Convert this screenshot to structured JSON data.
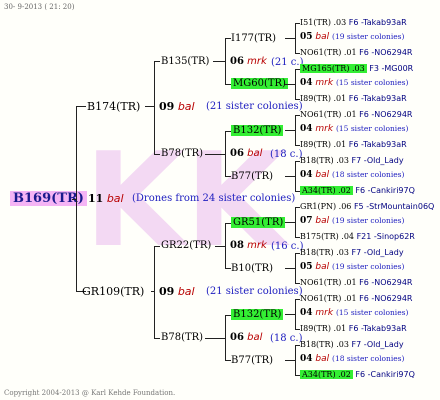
{
  "header_date": "30- 9-2013 ( 21: 20)",
  "copyright": "Copyright 2004-2013 @ Karl Kehde Foundation.",
  "watermark": "KK",
  "root": {
    "id": "B169(TR)",
    "num": "11",
    "mark": "bal",
    "note": "(Drones from 24 sister colonies)"
  },
  "upper": {
    "id": "B174(TR)",
    "num": "09",
    "mark": "bal",
    "note": "(21 sister colonies)",
    "a": {
      "id": "B135(TR)",
      "num": "06",
      "mark": "mrk",
      "note": "(21 c.)",
      "q1": "I177(TR)",
      "q2": "MG60(TR)"
    },
    "b": {
      "id": "B78(TR)",
      "num": "06",
      "mark": "bal",
      "note": "(18 c.)",
      "q1": "B132(TR)",
      "q2": "B77(TR)"
    }
  },
  "lower": {
    "id": "GR109(TR)",
    "num": "09",
    "mark": "bal",
    "note": "(21 sister colonies)",
    "a": {
      "id": "GR22(TR)",
      "num": "08",
      "mark": "mrk",
      "note": "(16 c.)",
      "q1": "GR51(TR)",
      "q2": "B10(TR)"
    },
    "b": {
      "id": "B78(TR)",
      "num": "06",
      "mark": "bal",
      "note": "(18 c.)",
      "q1": "B132(TR)",
      "q2": "B77(TR)"
    }
  },
  "gen4": [
    {
      "a": "I51(TR) .03",
      "b": "F6 -Takab93aR",
      "num": "05",
      "mark": "bal",
      "note": "(19 sister colonies)",
      "c": "NO61(TR) .01",
      "d": "F6 -NO6294R"
    },
    {
      "a": "MG165(TR) .03",
      "b": "F3 -MG00R",
      "num": "04",
      "mark": "mrk",
      "note": "(15 sister colonies)",
      "c": "I89(TR) .01",
      "d": "F6 -Takab93aR"
    },
    {
      "a": "NO61(TR) .01",
      "b": "F6 -NO6294R",
      "num": "04",
      "mark": "mrk",
      "note": "(15 sister colonies)",
      "c": "I89(TR) .01",
      "d": "F6 -Takab93aR"
    },
    {
      "a": "B18(TR) .03",
      "b": "F7 -Old_Lady",
      "num": "04",
      "mark": "bal",
      "note": "(18 sister colonies)",
      "c": "A34(TR) .02",
      "d": "F6 -Cankiri97Q"
    },
    {
      "a": "GR1(PN) .06",
      "b": "F5 -StrMountain06Q",
      "num": "07",
      "mark": "bal",
      "note": "(19 sister colonies)",
      "c": "B175(TR) .04",
      "d": "F21 -Sinop62R"
    },
    {
      "a": "B18(TR) .03",
      "b": "F7 -Old_Lady",
      "num": "05",
      "mark": "bal",
      "note": "(19 sister colonies)",
      "c": "NO61(TR) .01",
      "d": "F6 -NO6294R"
    },
    {
      "a": "NO61(TR) .01",
      "b": "F6 -NO6294R",
      "num": "04",
      "mark": "mrk",
      "note": "(15 sister colonies)",
      "c": "I89(TR) .01",
      "d": "F6 -Takab93aR"
    },
    {
      "a": "B18(TR) .03",
      "b": "F7 -Old_Lady",
      "num": "04",
      "mark": "bal",
      "note": "(18 sister colonies)",
      "c": "A34(TR) .02",
      "d": "F6 -Cankiri97Q"
    }
  ]
}
